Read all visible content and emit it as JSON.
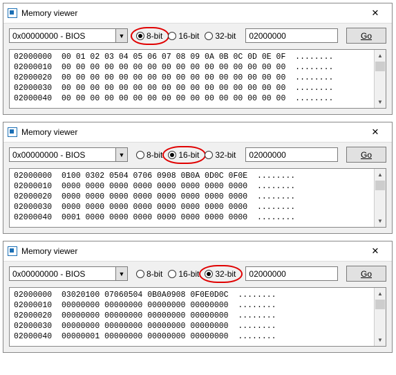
{
  "windows": [
    {
      "title": "Memory viewer",
      "region": "0x00000000 - BIOS",
      "radios": [
        {
          "label": "8-bit",
          "selected": true,
          "circled": true
        },
        {
          "label": "16-bit",
          "selected": false,
          "circled": false
        },
        {
          "label": "32-bit",
          "selected": false,
          "circled": false
        }
      ],
      "address": "02000000",
      "go": "Go",
      "hex": "02000000  00 01 02 03 04 05 06 07 08 09 0A 0B 0C 0D 0E 0F  ........\n02000010  00 00 00 00 00 00 00 00 00 00 00 00 00 00 00 00  ........\n02000020  00 00 00 00 00 00 00 00 00 00 00 00 00 00 00 00  ........\n02000030  00 00 00 00 00 00 00 00 00 00 00 00 00 00 00 00  ........\n02000040  00 00 00 00 00 00 00 00 00 00 00 00 00 00 00 00  ........"
    },
    {
      "title": "Memory viewer",
      "region": "0x00000000 - BIOS",
      "radios": [
        {
          "label": "8-bit",
          "selected": false,
          "circled": false
        },
        {
          "label": "16-bit",
          "selected": true,
          "circled": true
        },
        {
          "label": "32-bit",
          "selected": false,
          "circled": false
        }
      ],
      "address": "02000000",
      "go": "Go",
      "hex": "02000000  0100 0302 0504 0706 0908 0B0A 0D0C 0F0E  ........\n02000010  0000 0000 0000 0000 0000 0000 0000 0000  ........\n02000020  0000 0000 0000 0000 0000 0000 0000 0000  ........\n02000030  0000 0000 0000 0000 0000 0000 0000 0000  ........\n02000040  0001 0000 0000 0000 0000 0000 0000 0000  ........"
    },
    {
      "title": "Memory viewer",
      "region": "0x00000000 - BIOS",
      "radios": [
        {
          "label": "8-bit",
          "selected": false,
          "circled": false
        },
        {
          "label": "16-bit",
          "selected": false,
          "circled": false
        },
        {
          "label": "32-bit",
          "selected": true,
          "circled": true
        }
      ],
      "address": "02000000",
      "go": "Go",
      "hex": "02000000  03020100 07060504 0B0A0908 0F0E0D0C  ........\n02000010  00000000 00000000 00000000 00000000  ........\n02000020  00000000 00000000 00000000 00000000  ........\n02000030  00000000 00000000 00000000 00000000  ........\n02000040  00000001 00000000 00000000 00000000  ........"
    }
  ]
}
